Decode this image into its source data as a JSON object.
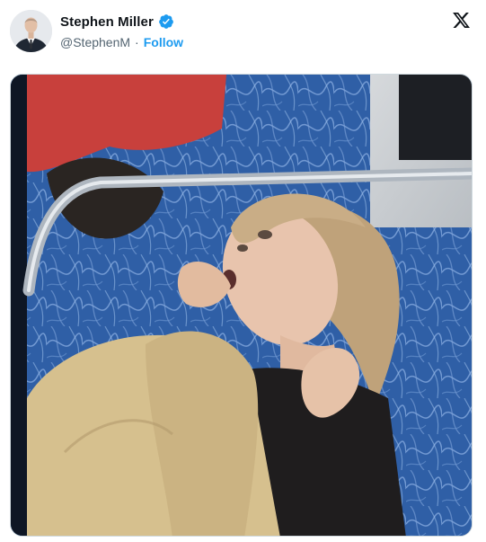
{
  "author": {
    "display_name": "Stephen Miller",
    "handle": "@StephenM",
    "separator": "·",
    "follow_label": "Follow",
    "verified": true
  },
  "icons": {
    "verified": "verified-badge-icon",
    "platform": "x-logo-icon"
  },
  "colors": {
    "verified_blue": "#1d9bf0",
    "follow_blue": "#1d9bf0",
    "name_text": "#0f1419",
    "handle_text": "#536471"
  },
  "media": {
    "type": "photo",
    "content": "woman seated on a train seat looking upward, hand near mouth"
  }
}
